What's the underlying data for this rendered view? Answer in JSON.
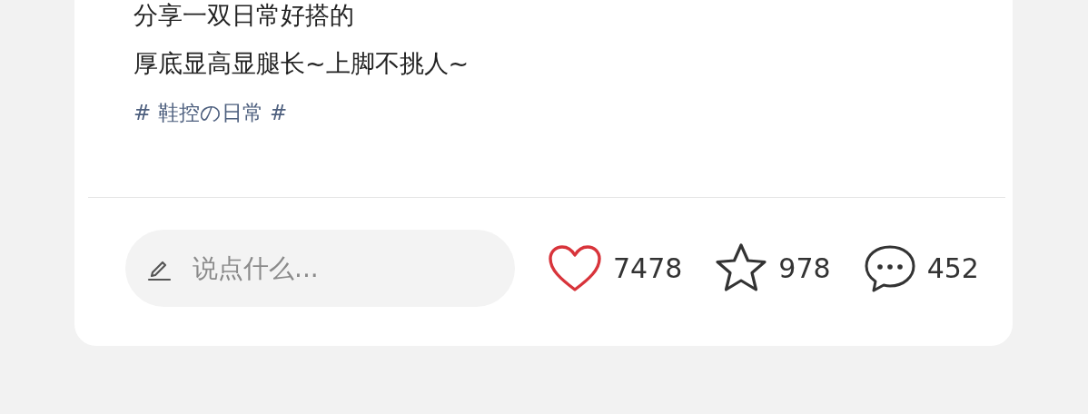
{
  "post": {
    "lines": [
      "分享一双日常好搭的",
      "厚底显高显腿长~上脚不挑人~"
    ],
    "tag": "# 鞋控の日常 #"
  },
  "footer": {
    "comment_field": {
      "placeholder": "说点什么..."
    },
    "actions": [
      {
        "kind": "like",
        "count": "7478",
        "selected": true
      },
      {
        "kind": "star",
        "count": "978",
        "selected": false
      },
      {
        "kind": "comment",
        "count": "452"
      }
    ]
  }
}
